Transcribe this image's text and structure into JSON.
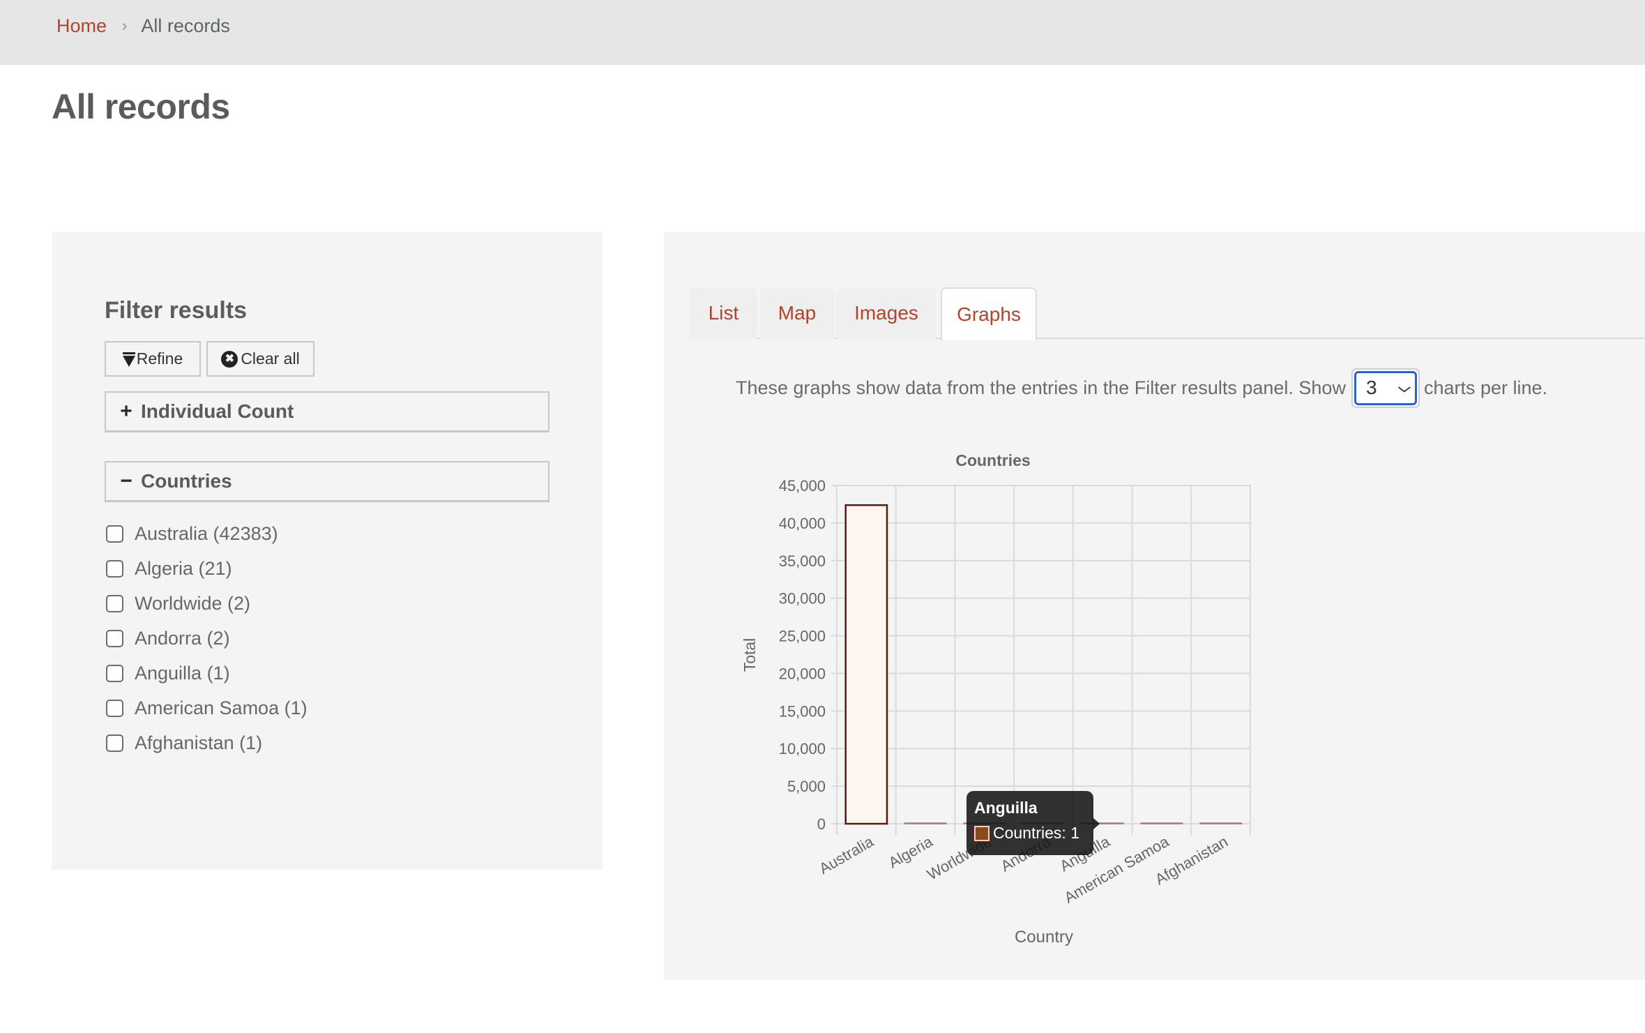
{
  "breadcrumb": {
    "home": "Home",
    "separator": "›",
    "current": "All records"
  },
  "page_title": "All records",
  "filter_panel": {
    "title": "Filter results",
    "refine_label": "Refine",
    "clear_label": "Clear all",
    "clear_icon_glyph": "✖",
    "facets": [
      {
        "label": "Individual Count",
        "state": "collapsed",
        "symbol": "+"
      },
      {
        "label": "Countries",
        "state": "expanded",
        "symbol": "−"
      }
    ],
    "countries": [
      {
        "label": "Australia (42383)",
        "checked": false
      },
      {
        "label": "Algeria (21)",
        "checked": false
      },
      {
        "label": "Worldwide (2)",
        "checked": false
      },
      {
        "label": "Andorra (2)",
        "checked": false
      },
      {
        "label": "Anguilla (1)",
        "checked": false
      },
      {
        "label": "American Samoa (1)",
        "checked": false
      },
      {
        "label": "Afghanistan (1)",
        "checked": false
      }
    ]
  },
  "tabs": [
    {
      "label": "List",
      "active": false
    },
    {
      "label": "Map",
      "active": false
    },
    {
      "label": "Images",
      "active": false
    },
    {
      "label": "Graphs",
      "active": true
    }
  ],
  "graphs_intro": {
    "before": "These graphs show data from the entries in the Filter results panel. Show",
    "select_value": "3",
    "after": "charts per line."
  },
  "colors": {
    "accent": "#b0442c",
    "bar_fill": "#fff7ef",
    "bar_border": "#5a1a12",
    "tooltip_swatch": "#8a4a1e"
  },
  "tooltip": {
    "title": "Anguilla",
    "series": "Countries",
    "value": "1",
    "text": "Countries: 1"
  },
  "chart_data": {
    "type": "bar",
    "title": "Countries",
    "xlabel": "Country",
    "ylabel": "Total",
    "categories": [
      "Australia",
      "Algeria",
      "Worldwide",
      "Andorra",
      "Anguilla",
      "American Samoa",
      "Afghanistan"
    ],
    "series": [
      {
        "name": "Countries",
        "values": [
          42383,
          21,
          2,
          2,
          1,
          1,
          1
        ]
      }
    ],
    "ylim": [
      0,
      45000
    ],
    "yticks": [
      0,
      5000,
      10000,
      15000,
      20000,
      25000,
      30000,
      35000,
      40000,
      45000
    ],
    "ytick_labels": [
      "0",
      "5,000",
      "10,000",
      "15,000",
      "20,000",
      "25,000",
      "30,000",
      "35,000",
      "40,000",
      "45,000"
    ],
    "grid": true,
    "legend": "none",
    "hovered_category": "Anguilla"
  }
}
